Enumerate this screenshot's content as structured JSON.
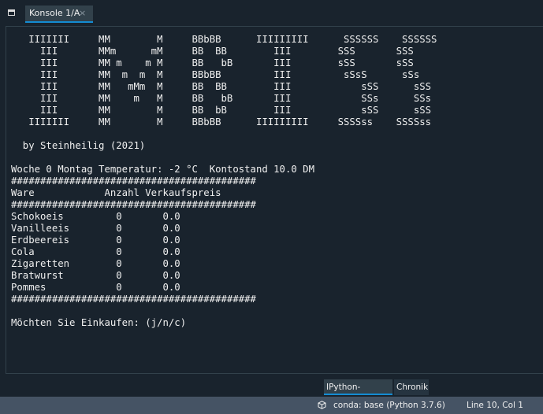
{
  "header": {
    "tab_label": "Konsole 1/A",
    "tab_close": "×",
    "pane_icon": "pane-options-icon"
  },
  "console": {
    "output": "   IIIIIII     MM        M     BBbBB      IIIIIIIII      SSSSSS    SSSSSS\n     III       MMm      mM     BB  BB        III        SSS       SSS\n     III       MM m    m M     BB   bB       III        sSS       sSS\n     III       MM  m  m  M     BBbBB         III         sSsS      sSs\n     III       MM   mMm  M     BB  BB        III            sSS      sSS\n     III       MM    m   M     BB   bB       III            SSs      SSs\n     III       MM        M     BB  bB        III            sSS      sSS\n   IIIIIII     MM        M     BBbBB      IIIIIIIII     SSSSss    SSSSss\n\n  by Steinheilig (2021)\n\nWoche 0 Montag Temperatur: -2 °C  Kontostand 10.0 DM\n##########################################\nWare            Anzahl Verkaufspreis\n##########################################\nSchokoeis         0       0.0\nVanilleeis        0       0.0\nErdbeereis        0       0.0\nCola              0       0.0\nZigaretten        0       0.0\nBratwurst         0       0.0\nPommes            0       0.0\n##########################################\n\nMöchten Sie Einkaufen: (j/n/c)"
  },
  "bottom_tabs": [
    {
      "label": "IPython-Konsole",
      "active": true
    },
    {
      "label": "Chronik",
      "active": false
    }
  ],
  "statusbar": {
    "env_icon": "package-icon",
    "env": "conda: base (Python 3.7.6)",
    "cursor": "Line 10, Col 1"
  },
  "colors": {
    "background": "#19232d",
    "tab_bg": "#32414b",
    "accent": "#148cd2",
    "statusbar_bg": "#455364",
    "text": "#f0f0f0"
  }
}
